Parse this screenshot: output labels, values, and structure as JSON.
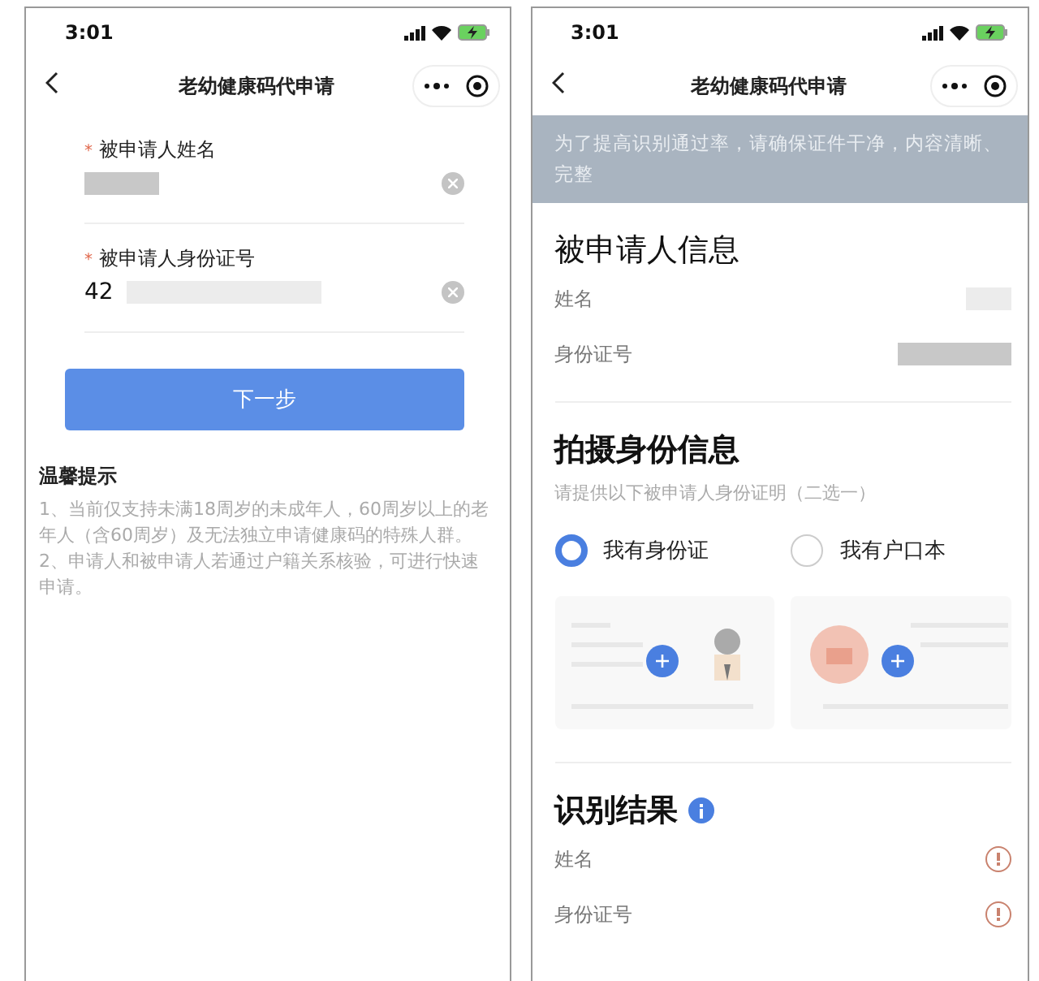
{
  "left_screen": {
    "status_bar": {
      "time": "3:01"
    },
    "nav": {
      "title": "老幼健康码代申请"
    },
    "fields": [
      {
        "label": "被申请人姓名",
        "required_mark": "*"
      },
      {
        "label": "被申请人身份证号",
        "required_mark": "*",
        "value": "42"
      }
    ],
    "next_button": "下一步",
    "tips": {
      "title": "温馨提示",
      "lines": [
        "1、当前仅支持未满18周岁的未成年人，60周岁以上的老年人（含60周岁）及无法独立申请健康码的特殊人群。",
        "2、申请人和被申请人若通过户籍关系核验，可进行快速申请。"
      ]
    }
  },
  "right_screen": {
    "status_bar": {
      "time": "3:01"
    },
    "nav": {
      "title": "老幼健康码代申请"
    },
    "banner": "为了提高识别通过率，请确保证件干净，内容清晰、完整",
    "applicant_section": {
      "title": "被申请人信息",
      "rows": [
        {
          "label": "姓名"
        },
        {
          "label": "身份证号"
        }
      ]
    },
    "photo_section": {
      "title": "拍摄身份信息",
      "subtitle": "请提供以下被申请人身份证明（二选一）",
      "options": [
        {
          "label": "我有身份证",
          "selected": true,
          "kind": "id-card"
        },
        {
          "label": "我有户口本",
          "selected": false,
          "kind": "household"
        }
      ]
    },
    "result_section": {
      "title": "识别结果",
      "rows": [
        {
          "label": "姓名"
        },
        {
          "label": "身份证号"
        }
      ]
    }
  }
}
